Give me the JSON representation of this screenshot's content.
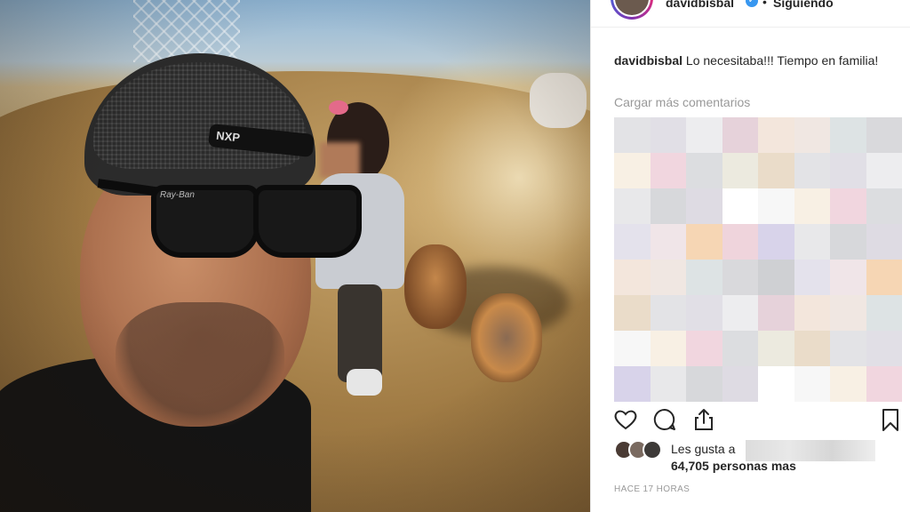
{
  "header": {
    "username": "davidbisbal",
    "separator": "•",
    "follow_status": "Siguiendo"
  },
  "caption": {
    "username": "davidbisbal",
    "text": "Lo necesitaba!!! Tiempo en familia!"
  },
  "comments": {
    "load_more_label": "Cargar más comentarios"
  },
  "likes": {
    "prefix": "Les gusta a",
    "count_text": "64,705 personas mas"
  },
  "timestamp": "HACE 17 HORAS",
  "icons": {
    "like": "heart-icon",
    "comment": "comment-icon",
    "share": "share-icon",
    "save": "bookmark-icon",
    "verified": "verified-badge-icon"
  },
  "colors": {
    "text": "#262626",
    "muted": "#999999",
    "verified": "#3897f0"
  }
}
